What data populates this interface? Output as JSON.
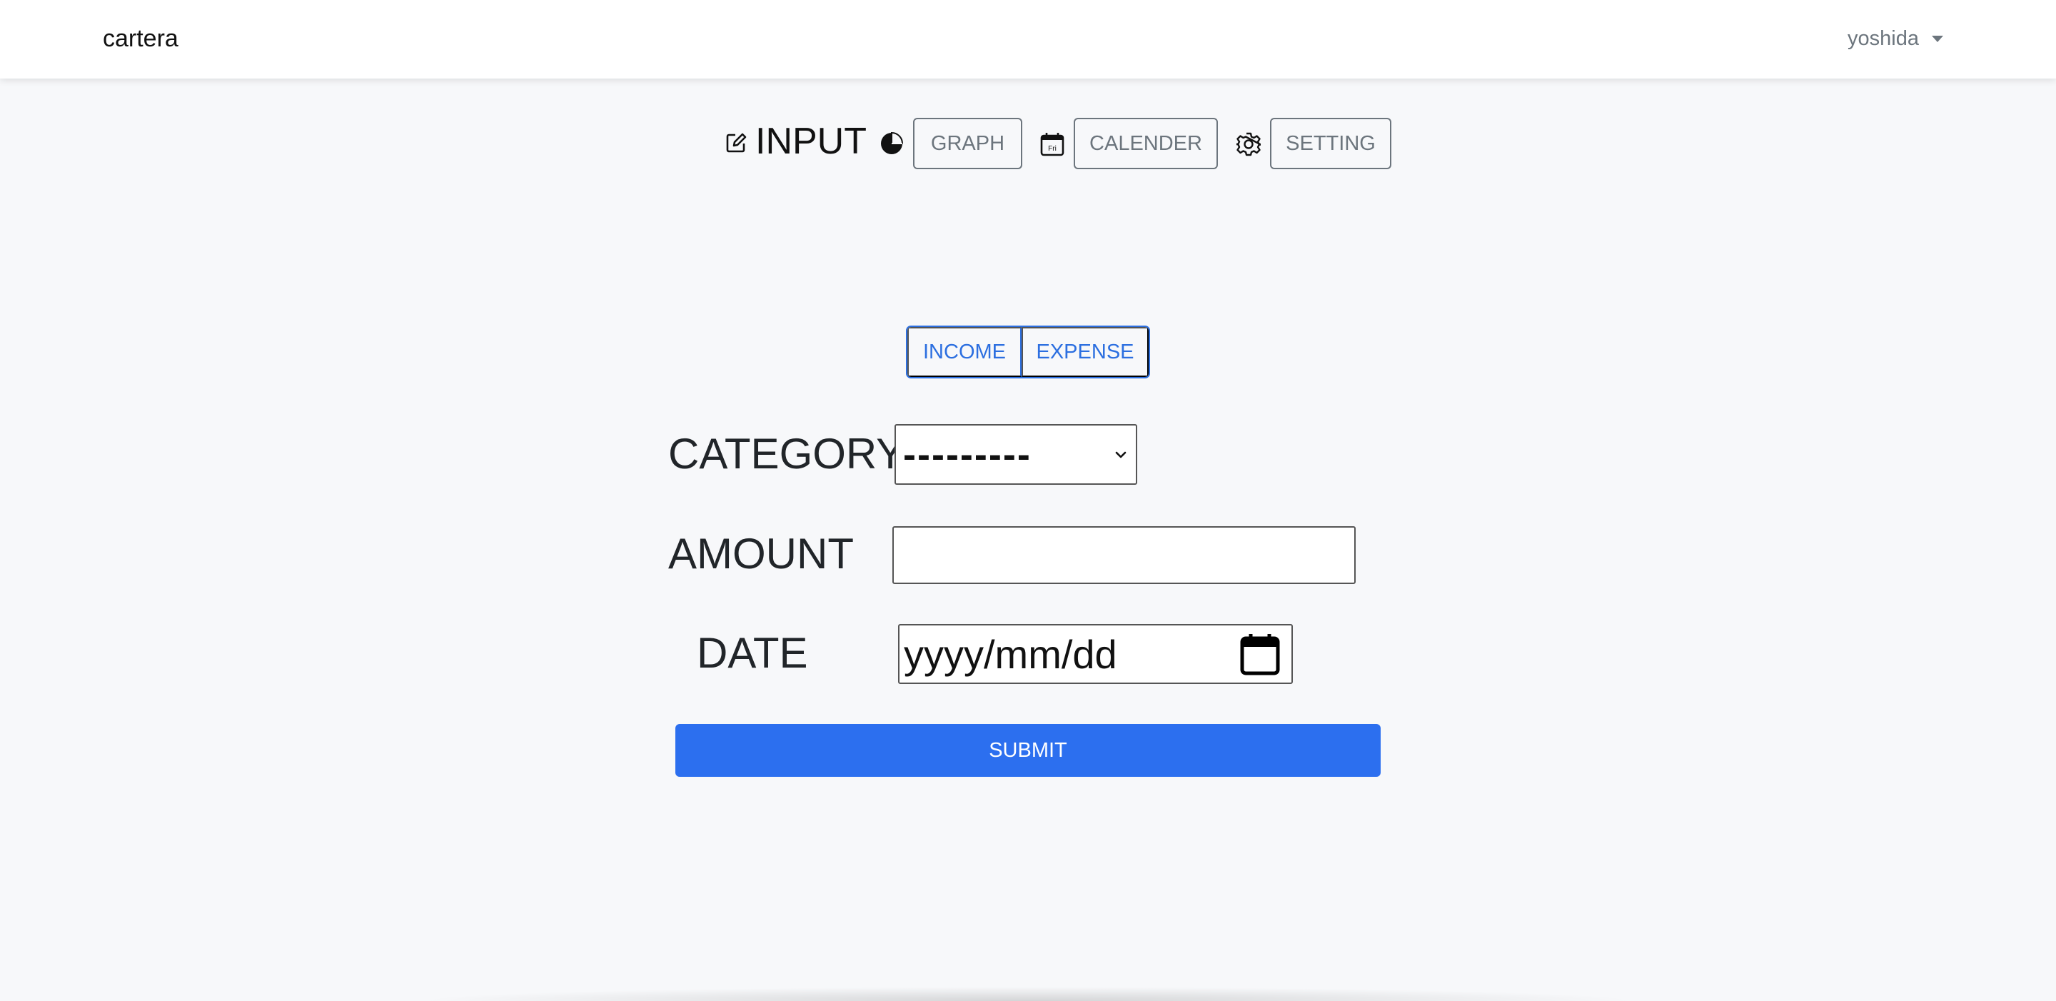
{
  "navbar": {
    "brand": "cartera",
    "user": "yoshida"
  },
  "nav": {
    "input_label": "INPUT",
    "graph_label": "GRAPH",
    "calendar_label": "CALENDER",
    "calendar_icon_text": "Fri",
    "setting_label": "SETTING"
  },
  "toggle": {
    "income": "INCOME",
    "expense": "EXPENSE"
  },
  "form": {
    "category_label": "CATEGORY",
    "category_value": "---------",
    "amount_label": "AMOUNT",
    "amount_value": "",
    "date_label": "DATE",
    "date_placeholder": "yyyy/mm/dd",
    "submit_label": "SUBMIT"
  },
  "icons": {
    "input": "pencil-square-icon",
    "graph": "pie-chart-icon",
    "calendar": "calendar-icon",
    "setting": "gear-icon",
    "date_picker": "calendar-icon"
  },
  "colors": {
    "primary": "#2c6fef",
    "outline_primary": "#2c6fe0",
    "outline_secondary": "#6c757d",
    "background": "#f7f8fa"
  }
}
